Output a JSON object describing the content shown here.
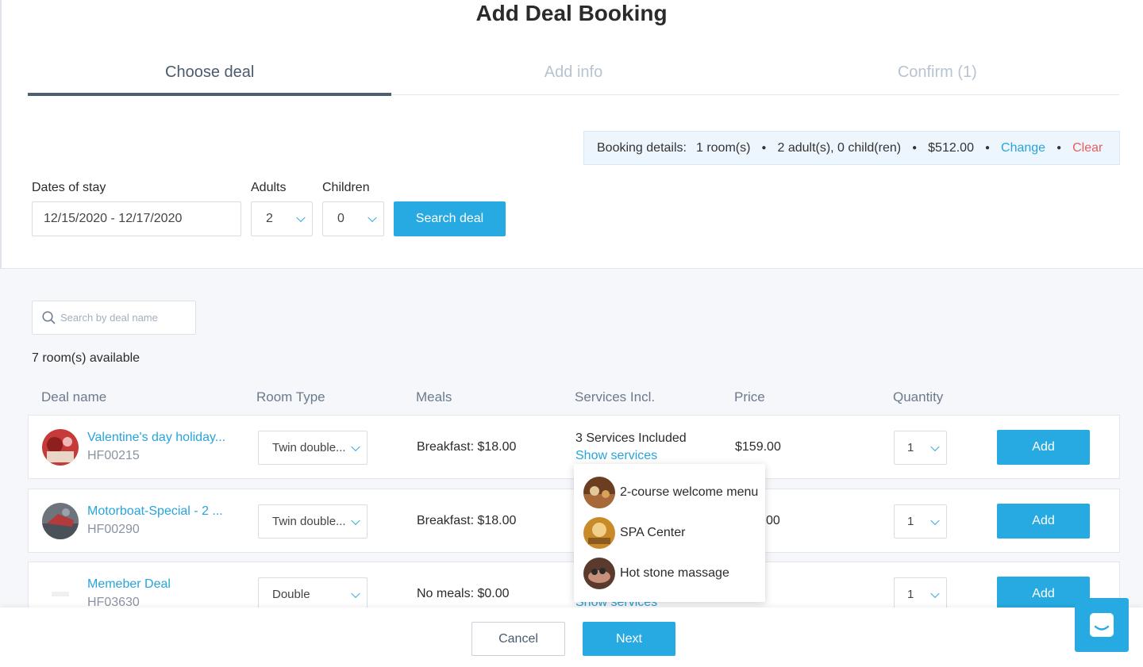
{
  "page": {
    "title": "Add Deal Booking"
  },
  "steps": [
    {
      "label": "Choose deal"
    },
    {
      "label": "Add info"
    },
    {
      "label": "Confirm (1)"
    }
  ],
  "booking_details": {
    "label": "Booking details:",
    "rooms": "1 room(s)",
    "guests": "2 adult(s), 0 child(ren)",
    "total": "$512.00",
    "change_label": "Change",
    "clear_label": "Clear"
  },
  "search_form": {
    "dates_label": "Dates of stay",
    "dates_value": "12/15/2020 - 12/17/2020",
    "adults_label": "Adults",
    "adults_value": "2",
    "children_label": "Children",
    "children_value": "0",
    "search_button": "Search deal"
  },
  "results": {
    "search_placeholder": "Search by deal name",
    "available_text": "7 room(s) available",
    "columns": [
      "Deal name",
      "Room Type",
      "Meals",
      "Services Incl.",
      "Price",
      "Quantity"
    ],
    "rows": [
      {
        "name": "Valentine's day holiday...",
        "code": "HF00215",
        "room_type": "Twin double...",
        "meals": "Breakfast: $18.00",
        "services": "3 Services Included",
        "services_link": "Show services",
        "price": "$159.00",
        "quantity": "1",
        "add_label": "Add"
      },
      {
        "name": "Motorboat-Special - 2 ...",
        "code": "HF00290",
        "room_type": "Twin double...",
        "meals": "Breakfast: $18.00",
        "price": "00",
        "quantity": "1",
        "add_label": "Add"
      },
      {
        "name": "Memeber Deal",
        "code": "HF03630",
        "room_type": "Double",
        "meals": "No meals: $0.00",
        "services_link": "Show services",
        "quantity": "1",
        "add_label": "Add"
      }
    ],
    "services_popover": [
      {
        "label": "2-course welcome menu",
        "icon": "food-thumbnail"
      },
      {
        "label": "SPA Center",
        "icon": "spa-thumbnail"
      },
      {
        "label": "Hot stone massage",
        "icon": "massage-thumbnail"
      }
    ]
  },
  "footer": {
    "cancel_label": "Cancel",
    "next_label": "Next"
  },
  "colors": {
    "accent": "#27a9e1",
    "link": "#27a4dd",
    "danger": "#ef5b5b",
    "step_active": "#4d5d72"
  }
}
